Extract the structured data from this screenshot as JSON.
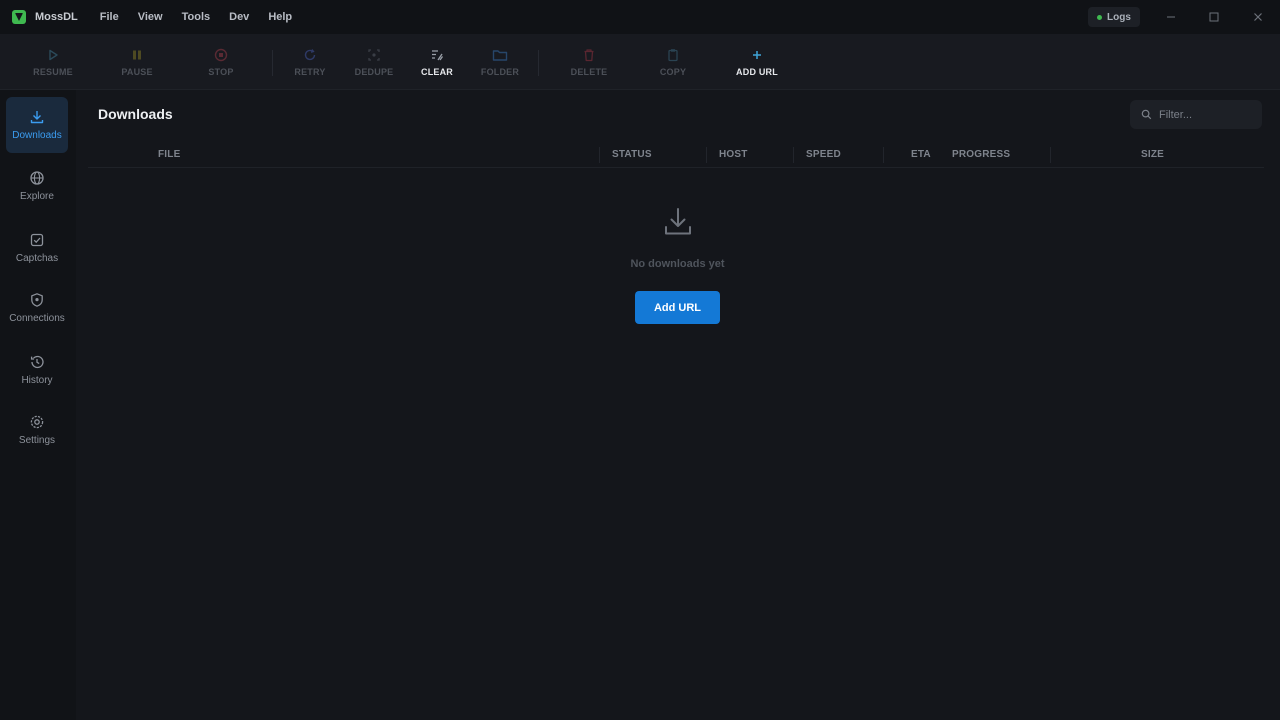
{
  "app": {
    "name": "MossDL"
  },
  "menu": [
    "File",
    "View",
    "Tools",
    "Dev",
    "Help"
  ],
  "titlebar": {
    "logs_label": "Logs"
  },
  "toolbar": {
    "resume": "RESUME",
    "pause": "PAUSE",
    "stop": "STOP",
    "retry": "RETRY",
    "dedupe": "DEDUPE",
    "clear": "CLEAR",
    "folder": "FOLDER",
    "delete": "DELETE",
    "copy": "COPY",
    "add_url": "ADD URL"
  },
  "sidebar": {
    "items": [
      {
        "label": "Downloads",
        "icon": "download-icon",
        "active": true
      },
      {
        "label": "Explore",
        "icon": "globe-icon",
        "active": false
      },
      {
        "label": "Captchas",
        "icon": "captcha-icon",
        "active": false
      },
      {
        "label": "Connections",
        "icon": "shield-icon",
        "active": false
      },
      {
        "label": "History",
        "icon": "history-icon",
        "active": false
      },
      {
        "label": "Settings",
        "icon": "gear-icon",
        "active": false
      }
    ]
  },
  "main": {
    "title": "Downloads",
    "filter_placeholder": "Filter...",
    "columns": {
      "file": "FILE",
      "status": "STATUS",
      "host": "HOST",
      "speed": "SPEED",
      "eta": "ETA",
      "progress": "PROGRESS",
      "size": "SIZE"
    },
    "empty_text": "No downloads yet",
    "add_url_button": "Add URL"
  },
  "colors": {
    "accent": "#1479d6",
    "active_nav": "#3b9cf0",
    "background": "#14161b",
    "status_dot": "#3fb950"
  }
}
